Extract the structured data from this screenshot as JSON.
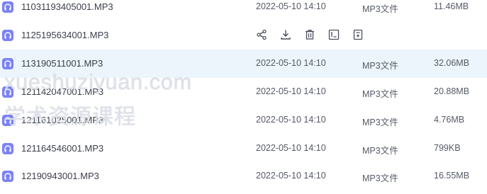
{
  "files": [
    {
      "name": "11031193405001.MP3",
      "date": "2022-05-10 14:10",
      "type": "MP3文件",
      "size": "11.46MB"
    },
    {
      "name": "1125195634001.MP3",
      "date": "",
      "type": "",
      "size": "",
      "hovered": true
    },
    {
      "name": "113190511001.MP3",
      "date": "2022-05-10 14:10",
      "type": "MP3文件",
      "size": "32.06MB",
      "selected": true
    },
    {
      "name": "121142047001.MP3",
      "date": "2022-05-10 14:10",
      "type": "MP3文件",
      "size": "20.88MB"
    },
    {
      "name": "121161025001.MP3",
      "date": "2022-05-10 14:10",
      "type": "MP3文件",
      "size": "4.76MB"
    },
    {
      "name": "121164546001.MP3",
      "date": "2022-05-10 14:10",
      "type": "MP3文件",
      "size": "799KB"
    },
    {
      "name": "12190943001.MP3",
      "date": "2022-05-10 14:10",
      "type": "MP3文件",
      "size": "16.55MB"
    }
  ],
  "row_actions": [
    "share-icon",
    "download-icon",
    "delete-icon",
    "rename-icon",
    "more-icon"
  ],
  "watermark": {
    "line1": "xueshuziyuan.com",
    "line2": "学术资源课程"
  },
  "colors": {
    "accent_icon": "#7b82f4",
    "selected_row": "#edf5fc",
    "text": "#3b3f4a"
  }
}
